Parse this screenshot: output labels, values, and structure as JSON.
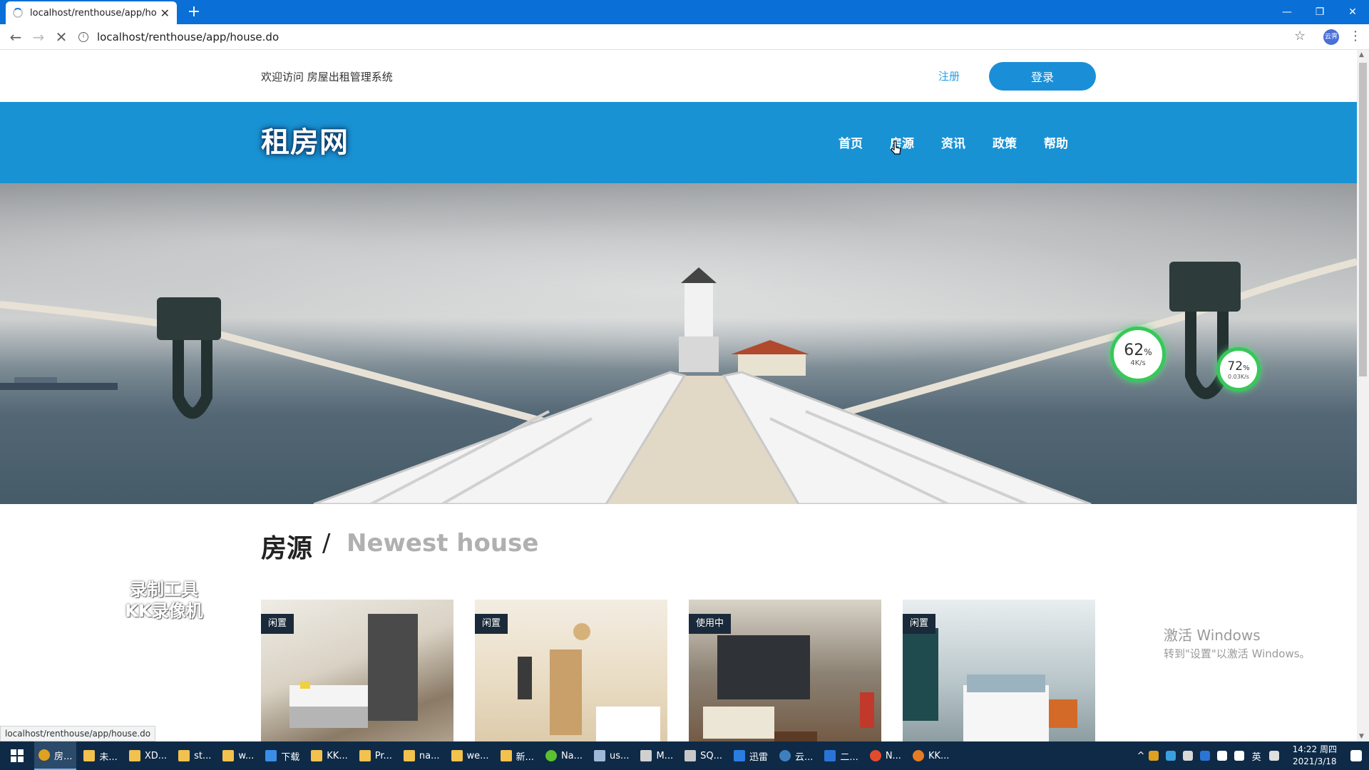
{
  "browser": {
    "tab_title": "localhost/renthouse/app/hou",
    "new_tab": "+",
    "address": "localhost/renthouse/app/house.do",
    "status_url": "localhost/renthouse/app/house.do",
    "profile_badge": "云霁"
  },
  "topbar": {
    "welcome": "欢迎访问 房屋出租管理系统",
    "register": "注册",
    "login": "登录"
  },
  "navbar": {
    "brand": "租房网",
    "items": [
      "首页",
      "房源",
      "资讯",
      "政策",
      "帮助"
    ]
  },
  "speed_widgets": [
    {
      "percent": "62",
      "unit": "%",
      "rate": "4K/s"
    },
    {
      "percent": "72",
      "unit": "%",
      "rate": "0.03K/s"
    }
  ],
  "section": {
    "title": "房源",
    "separator": "/",
    "subtitle": "Newest house"
  },
  "houses": [
    {
      "status": "闲置"
    },
    {
      "status": "闲置"
    },
    {
      "status": "使用中"
    },
    {
      "status": "闲置"
    }
  ],
  "overlays": {
    "recorder_line1": "录制工具",
    "recorder_line2": "KK录像机",
    "activate_title": "激活 Windows",
    "activate_hint": "转到\"设置\"以激活 Windows。"
  },
  "taskbar": {
    "items": [
      "房...",
      "未...",
      "XD...",
      "st...",
      "w...",
      "下载",
      "KK...",
      "Pr...",
      "na...",
      "we...",
      "新...",
      "Na...",
      "us...",
      "M...",
      "SQ...",
      "迅雷",
      "云...",
      "二...",
      "N...",
      "KK..."
    ],
    "ime": "英",
    "time": "14:22 周四",
    "date": "2021/3/18"
  },
  "colors": {
    "accent": "#1992d4",
    "chrome": "#0a6fd6",
    "taskbar": "#0e2a47",
    "widget_ring": "#37c85a"
  }
}
